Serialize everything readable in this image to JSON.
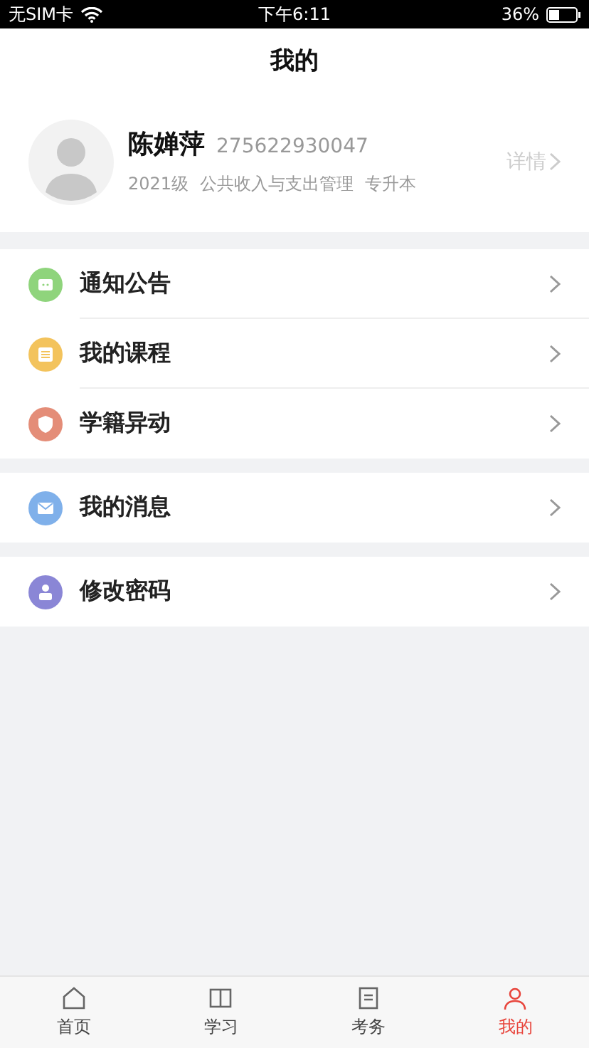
{
  "status_bar": {
    "carrier": "无SIM卡",
    "time": "下午6:11",
    "battery": "36%"
  },
  "nav": {
    "title": "我的"
  },
  "profile": {
    "name": "陈婵萍",
    "id": "275622930047",
    "grade": "2021级",
    "major": "公共收入与支出管理",
    "level": "专升本",
    "details": "详情"
  },
  "menu_groups": [
    {
      "items": [
        {
          "label": "通知公告",
          "kind": "notice",
          "color": "#8fd47c"
        },
        {
          "label": "我的课程",
          "kind": "course",
          "color": "#f3c35c"
        },
        {
          "label": "学籍异动",
          "kind": "shield",
          "color": "#e48d78"
        }
      ]
    },
    {
      "items": [
        {
          "label": "我的消息",
          "kind": "mail",
          "color": "#7fb0ea"
        }
      ]
    },
    {
      "items": [
        {
          "label": "修改密码",
          "kind": "user",
          "color": "#8a86d6"
        }
      ]
    }
  ],
  "tabs": [
    {
      "label": "首页",
      "kind": "home",
      "selected": false
    },
    {
      "label": "学习",
      "kind": "book",
      "selected": false
    },
    {
      "label": "考务",
      "kind": "exam",
      "selected": false
    },
    {
      "label": "我的",
      "kind": "me",
      "selected": true
    }
  ]
}
